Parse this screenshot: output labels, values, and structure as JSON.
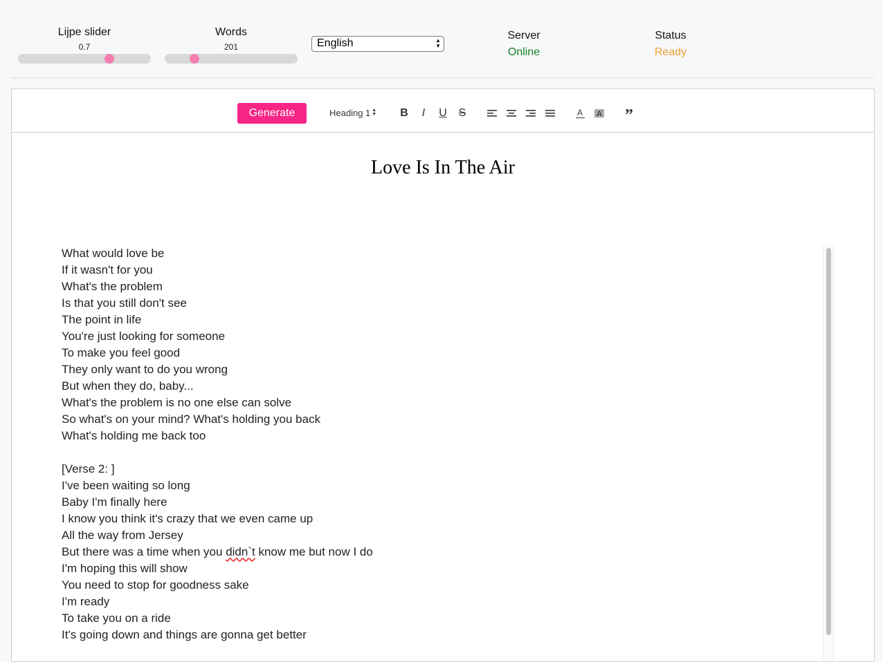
{
  "controls": {
    "lijpe_slider": {
      "label": "Lijpe slider",
      "value": "0.7",
      "fraction": 0.7
    },
    "words": {
      "label": "Words",
      "value": "201",
      "fraction": 0.2
    },
    "language": {
      "selected": "English"
    },
    "server": {
      "label": "Server",
      "value": "Online",
      "color": "#15801f"
    },
    "status": {
      "label": "Status",
      "value": "Ready",
      "color": "#f0a030"
    }
  },
  "colors": {
    "accent": "#f72585",
    "slider_thumb": "#f47eb0"
  },
  "toolbar": {
    "generate_label": "Generate",
    "heading_select": "Heading 1",
    "buttons": [
      {
        "name": "bold-icon",
        "glyph": "B"
      },
      {
        "name": "italic-icon",
        "glyph": "I"
      },
      {
        "name": "underline-icon",
        "glyph": "U"
      },
      {
        "name": "strikethrough-icon",
        "glyph": "S"
      },
      {
        "name": "align-left-icon",
        "glyph": ""
      },
      {
        "name": "align-center-icon",
        "glyph": ""
      },
      {
        "name": "align-right-icon",
        "glyph": ""
      },
      {
        "name": "align-justify-icon",
        "glyph": ""
      },
      {
        "name": "text-color-icon",
        "glyph": "A"
      },
      {
        "name": "highlight-color-icon",
        "glyph": "A"
      },
      {
        "name": "blockquote-icon",
        "glyph": "”"
      }
    ]
  },
  "document": {
    "title": "Love Is In The Air",
    "lines": [
      "What would love be",
      "If it wasn't for you",
      "What's the problem",
      "Is that you still don't see",
      "The point in life",
      "You're just looking for someone",
      "To make you feel good",
      "They only want to do you wrong",
      "But when they do, baby...",
      "What's the problem is no one else can solve",
      "So what's on your mind? What's holding you back",
      "What's holding me back too",
      "",
      "[Verse 2: ]",
      "I've been waiting so long",
      "Baby I'm finally here",
      "I know you think it's crazy that we even came up",
      "All the way from Jersey",
      "But there was a time when you didn`t know me but now I do",
      "I'm hoping this will show",
      "You need to stop for goodness sake",
      "I'm ready",
      "To take you on a ride",
      "It's going down and things are gonna get better"
    ]
  }
}
